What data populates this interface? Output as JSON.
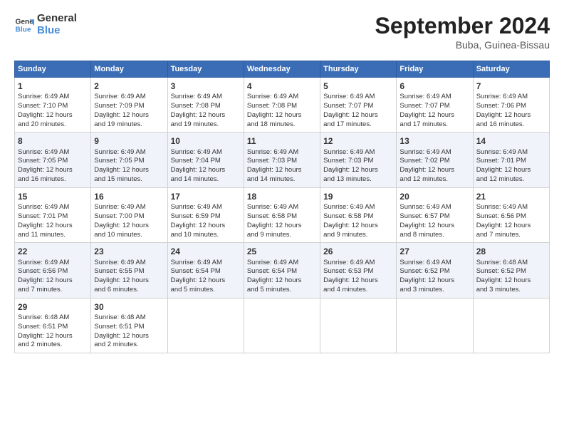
{
  "logo": {
    "line1": "General",
    "line2": "Blue"
  },
  "title": "September 2024",
  "location": "Buba, Guinea-Bissau",
  "days_header": [
    "Sunday",
    "Monday",
    "Tuesday",
    "Wednesday",
    "Thursday",
    "Friday",
    "Saturday"
  ],
  "weeks": [
    [
      {
        "day": "1",
        "rise": "6:49 AM",
        "set": "7:10 PM",
        "hours": "12",
        "mins": "20"
      },
      {
        "day": "2",
        "rise": "6:49 AM",
        "set": "7:09 PM",
        "hours": "12",
        "mins": "19"
      },
      {
        "day": "3",
        "rise": "6:49 AM",
        "set": "7:08 PM",
        "hours": "12",
        "mins": "19"
      },
      {
        "day": "4",
        "rise": "6:49 AM",
        "set": "7:08 PM",
        "hours": "12",
        "mins": "18"
      },
      {
        "day": "5",
        "rise": "6:49 AM",
        "set": "7:07 PM",
        "hours": "12",
        "mins": "17"
      },
      {
        "day": "6",
        "rise": "6:49 AM",
        "set": "7:07 PM",
        "hours": "12",
        "mins": "17"
      },
      {
        "day": "7",
        "rise": "6:49 AM",
        "set": "7:06 PM",
        "hours": "12",
        "mins": "16"
      }
    ],
    [
      {
        "day": "8",
        "rise": "6:49 AM",
        "set": "7:05 PM",
        "hours": "12",
        "mins": "16"
      },
      {
        "day": "9",
        "rise": "6:49 AM",
        "set": "7:05 PM",
        "hours": "12",
        "mins": "15"
      },
      {
        "day": "10",
        "rise": "6:49 AM",
        "set": "7:04 PM",
        "hours": "12",
        "mins": "14"
      },
      {
        "day": "11",
        "rise": "6:49 AM",
        "set": "7:03 PM",
        "hours": "12",
        "mins": "14"
      },
      {
        "day": "12",
        "rise": "6:49 AM",
        "set": "7:03 PM",
        "hours": "12",
        "mins": "13"
      },
      {
        "day": "13",
        "rise": "6:49 AM",
        "set": "7:02 PM",
        "hours": "12",
        "mins": "12"
      },
      {
        "day": "14",
        "rise": "6:49 AM",
        "set": "7:01 PM",
        "hours": "12",
        "mins": "12"
      }
    ],
    [
      {
        "day": "15",
        "rise": "6:49 AM",
        "set": "7:01 PM",
        "hours": "12",
        "mins": "11"
      },
      {
        "day": "16",
        "rise": "6:49 AM",
        "set": "7:00 PM",
        "hours": "12",
        "mins": "10"
      },
      {
        "day": "17",
        "rise": "6:49 AM",
        "set": "6:59 PM",
        "hours": "12",
        "mins": "10"
      },
      {
        "day": "18",
        "rise": "6:49 AM",
        "set": "6:58 PM",
        "hours": "12",
        "mins": "9"
      },
      {
        "day": "19",
        "rise": "6:49 AM",
        "set": "6:58 PM",
        "hours": "12",
        "mins": "9"
      },
      {
        "day": "20",
        "rise": "6:49 AM",
        "set": "6:57 PM",
        "hours": "12",
        "mins": "8"
      },
      {
        "day": "21",
        "rise": "6:49 AM",
        "set": "6:56 PM",
        "hours": "12",
        "mins": "7"
      }
    ],
    [
      {
        "day": "22",
        "rise": "6:49 AM",
        "set": "6:56 PM",
        "hours": "12",
        "mins": "7"
      },
      {
        "day": "23",
        "rise": "6:49 AM",
        "set": "6:55 PM",
        "hours": "12",
        "mins": "6"
      },
      {
        "day": "24",
        "rise": "6:49 AM",
        "set": "6:54 PM",
        "hours": "12",
        "mins": "5"
      },
      {
        "day": "25",
        "rise": "6:49 AM",
        "set": "6:54 PM",
        "hours": "12",
        "mins": "5"
      },
      {
        "day": "26",
        "rise": "6:49 AM",
        "set": "6:53 PM",
        "hours": "12",
        "mins": "4"
      },
      {
        "day": "27",
        "rise": "6:49 AM",
        "set": "6:52 PM",
        "hours": "12",
        "mins": "3"
      },
      {
        "day": "28",
        "rise": "6:48 AM",
        "set": "6:52 PM",
        "hours": "12",
        "mins": "3"
      }
    ],
    [
      {
        "day": "29",
        "rise": "6:48 AM",
        "set": "6:51 PM",
        "hours": "12",
        "mins": "2"
      },
      {
        "day": "30",
        "rise": "6:48 AM",
        "set": "6:51 PM",
        "hours": "12",
        "mins": "2"
      },
      null,
      null,
      null,
      null,
      null
    ]
  ]
}
